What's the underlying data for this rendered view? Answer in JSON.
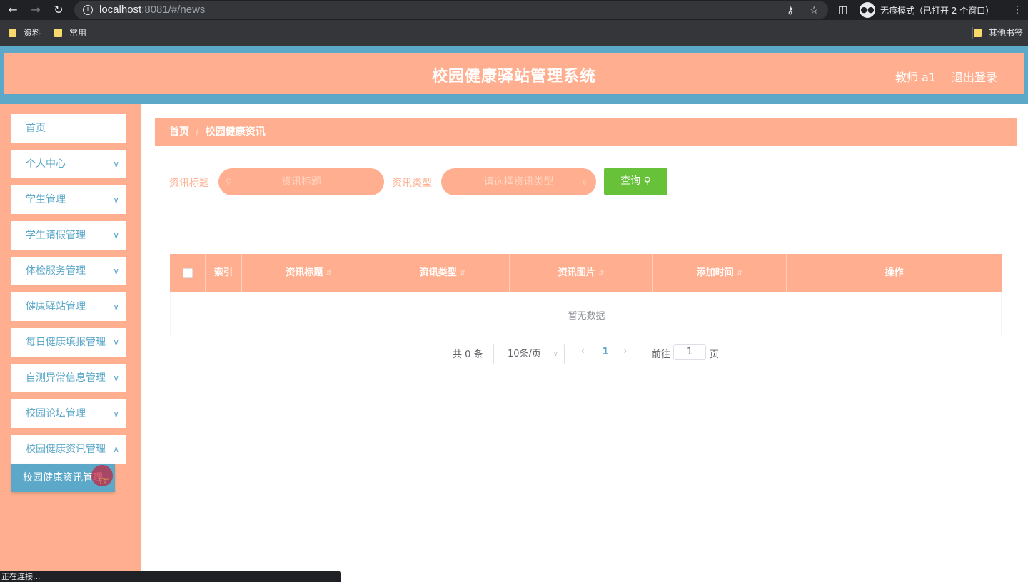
{
  "browser": {
    "url_host": "localhost",
    "url_rest": ":8081/#/news",
    "incognito_text": "无痕模式（已打开 2 个窗口）",
    "bookmarks": [
      "资料",
      "常用"
    ],
    "other_bookmarks": "其他书签",
    "status_text": "正在连接..."
  },
  "header": {
    "title": "校园健康驿站管理系统",
    "user": "教师 a1",
    "logout": "退出登录"
  },
  "sidebar": {
    "items": [
      {
        "label": "首页"
      },
      {
        "label": "个人中心"
      },
      {
        "label": "学生管理"
      },
      {
        "label": "学生请假管理"
      },
      {
        "label": "体检服务管理"
      },
      {
        "label": "健康驿站管理"
      },
      {
        "label": "每日健康填报管理"
      },
      {
        "label": "自测异常信息管理"
      },
      {
        "label": "校园论坛管理"
      },
      {
        "label": "校园健康资讯管理"
      }
    ],
    "active_sub": "校园健康资讯管理"
  },
  "breadcrumb": {
    "home": "首页",
    "current": "校园健康资讯"
  },
  "search": {
    "title_label": "资讯标题",
    "title_placeholder": "资讯标题",
    "type_label": "资讯类型",
    "type_placeholder": "请选择资讯类型",
    "query_button": "查询"
  },
  "table": {
    "columns": [
      "索引",
      "资讯标题",
      "资讯类型",
      "资讯图片",
      "添加时间",
      "操作"
    ],
    "empty_text": "暂无数据"
  },
  "pagination": {
    "total": "共 0 条",
    "page_size": "10条/页",
    "current_page": "1",
    "goto_label": "前往",
    "goto_value": "1",
    "page_suffix": "页"
  },
  "colors": {
    "primary": "#ffaf8f",
    "accent": "#5ba8c8",
    "button": "#67c23a"
  }
}
